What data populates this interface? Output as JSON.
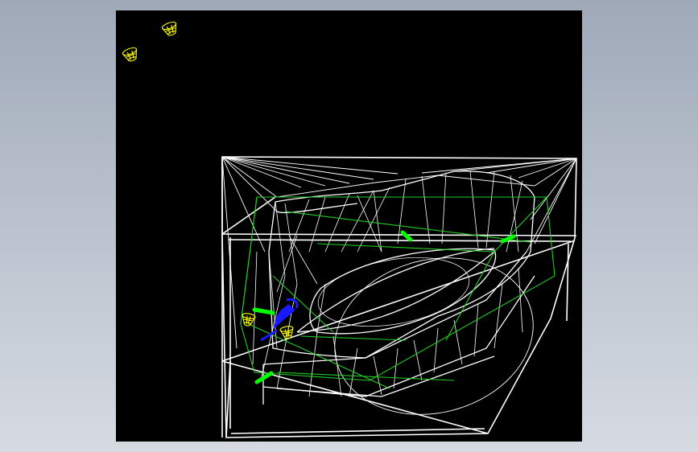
{
  "viewport": {
    "background_color": "#000000",
    "page_background": "#b0b8c4"
  },
  "model": {
    "wire_color": "#ffffff",
    "guide_color": "#22cc22",
    "icon_color": "#ffff00",
    "arrow_color": "#00ff00",
    "handle_color": "#1a1aff",
    "icons": [
      "light-icon",
      "light-icon",
      "light-icon",
      "light-icon"
    ],
    "arrows": [
      "drag-arrow",
      "drag-arrow",
      "drag-arrow",
      "drag-arrow"
    ]
  }
}
